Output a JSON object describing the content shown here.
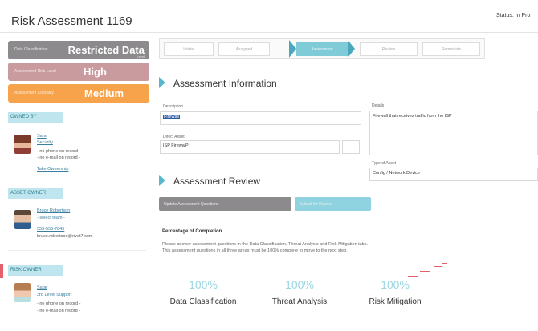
{
  "header": {
    "title": "Risk Assessment 1169",
    "status": "Status: In Pro"
  },
  "classification": {
    "restricted": {
      "caption": "Data Classification",
      "value": "Restricted Data",
      "tiny": "Level"
    },
    "high": {
      "caption": "Assessment Risk Level",
      "value": "High"
    },
    "medium": {
      "caption": "Assessment Criticality",
      "value": "Medium"
    }
  },
  "owned_by": {
    "section": "OWNED BY",
    "name": "Sara",
    "team": "Security",
    "phone": "- no phone on record -",
    "email": "- no e-mail on record -",
    "link": "Take Ownership"
  },
  "asset_owner": {
    "section": "ASSET OWNER",
    "name": "Bruce Robertson",
    "team": "- select team -",
    "phone": "555-555-7845",
    "email": "bruce.robertson@rivet7.com"
  },
  "risk_owner": {
    "section": "RISK OWNER",
    "name": "Sage",
    "team": "3rd Level Support",
    "phone": "- no phone on record -",
    "email": "- no e-mail on record -"
  },
  "steps": [
    "Intake",
    "Assigned",
    "Assessment",
    "Review",
    "Remediate"
  ],
  "assessment_info": {
    "heading": "Assessment Information",
    "description_label": "Description",
    "description_value": "Firewall",
    "details_label": "Details",
    "details_value": "Firewall that receives traffic from the ISP",
    "direct_asset_label": "Direct Asset",
    "direct_asset_value": "ISP FirewalP",
    "type_label": "Type of Asset",
    "type_value": "Config / Network Device"
  },
  "assessment_review": {
    "heading": "Assessment Review",
    "btn_primary": "Update Assessment Questions",
    "btn_secondary": "Submit for Review",
    "completion_title": "Percentage of Completion",
    "completion_line1": "Please answer assessment questions in the Data Classification, Threat Analysis and Risk Mitigation tabs.",
    "completion_line2": "This assessment questions in all three areas must be 100% complete to move to the next step."
  },
  "completion": [
    {
      "pct": "100%",
      "label": "Data Classification"
    },
    {
      "pct": "100%",
      "label": "Threat Analysis"
    },
    {
      "pct": "100%",
      "label": "Risk Mitigation"
    }
  ],
  "colors": {
    "accent": "#59b7cb",
    "restricted": "#8c8a8c",
    "high": "#c99a9e",
    "medium": "#f7a34b",
    "pct": "#9ad6e2"
  }
}
